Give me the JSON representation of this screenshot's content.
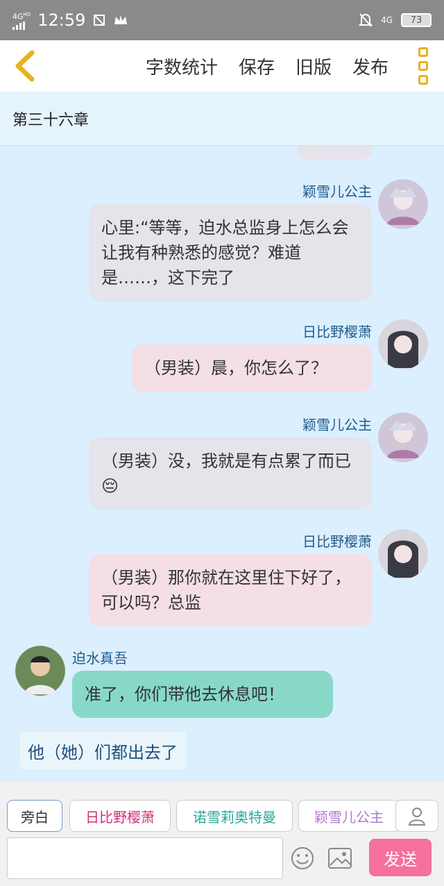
{
  "status": {
    "network": "4G",
    "hd": "HD",
    "time": "12:59",
    "net_right": "4G",
    "battery": "73"
  },
  "toolbar": {
    "items": [
      "字数统计",
      "保存",
      "旧版",
      "发布"
    ]
  },
  "chapter": "第三十六章",
  "messages": [
    {
      "name": "颖雪儿公主",
      "text": "心里:“等等，迫水总监身上怎么会让我有种熟悉的感觉？难道是……，这下完了"
    },
    {
      "name": "日比野樱萧",
      "text": "（男装）晨，你怎么了？"
    },
    {
      "name": "颖雪儿公主",
      "text": "（男装）没，我就是有点累了而已😔"
    },
    {
      "name": "日比野樱萧",
      "text": "（男装）那你就在这里住下好了，可以吗？总监"
    },
    {
      "name": "迫水真吾",
      "text": "准了，你们带他去休息吧！"
    }
  ],
  "narration": "他（她）们都出去了",
  "roles": [
    "旁白",
    "日比野樱萧",
    "诺雪莉奥特曼",
    "颖雪儿公主"
  ],
  "send_label": "发送",
  "colors": {
    "accent": "#e8b11f",
    "send": "#f5709e",
    "name": "#1e5b8c"
  }
}
